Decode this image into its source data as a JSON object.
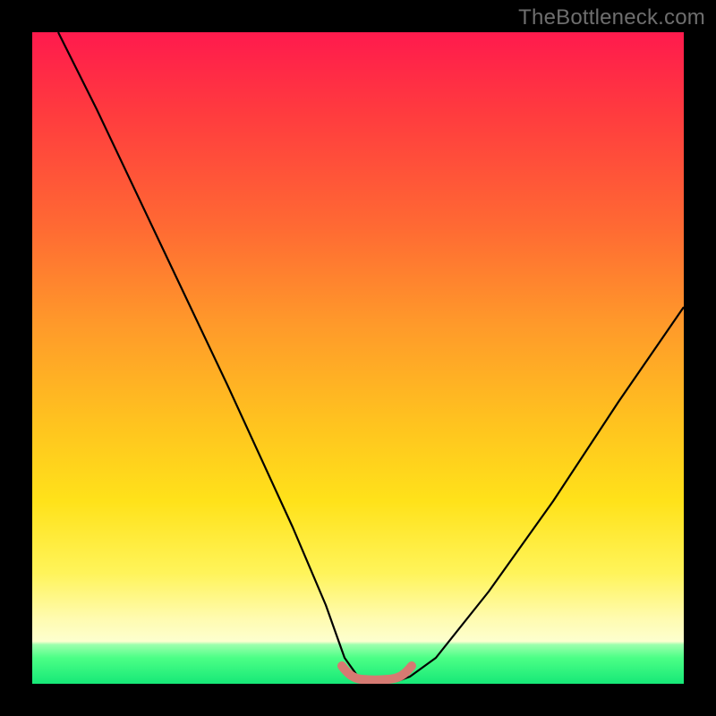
{
  "watermark": "TheBottleneck.com",
  "chart_data": {
    "type": "line",
    "title": "",
    "xlabel": "",
    "ylabel": "",
    "xlim": [
      0,
      100
    ],
    "ylim": [
      0,
      100
    ],
    "series": [
      {
        "name": "bottleneck-curve",
        "x": [
          4,
          10,
          20,
          30,
          40,
          45,
          48,
          50,
          52,
          54,
          56,
          58,
          62,
          70,
          80,
          90,
          100
        ],
        "values": [
          100,
          88,
          67,
          46,
          24,
          12,
          4,
          1,
          0,
          0,
          0,
          1,
          4,
          14,
          28,
          43,
          58
        ]
      },
      {
        "name": "flat-min-highlight",
        "x": [
          48,
          50,
          52,
          54,
          56,
          58
        ],
        "values": [
          1.5,
          0.7,
          0.5,
          0.5,
          0.7,
          1.5
        ]
      }
    ],
    "annotations": []
  },
  "colors": {
    "curve": "#000000",
    "highlight": "#d67a72",
    "background_top": "#ff1a4d",
    "background_bottom": "#16e877"
  }
}
